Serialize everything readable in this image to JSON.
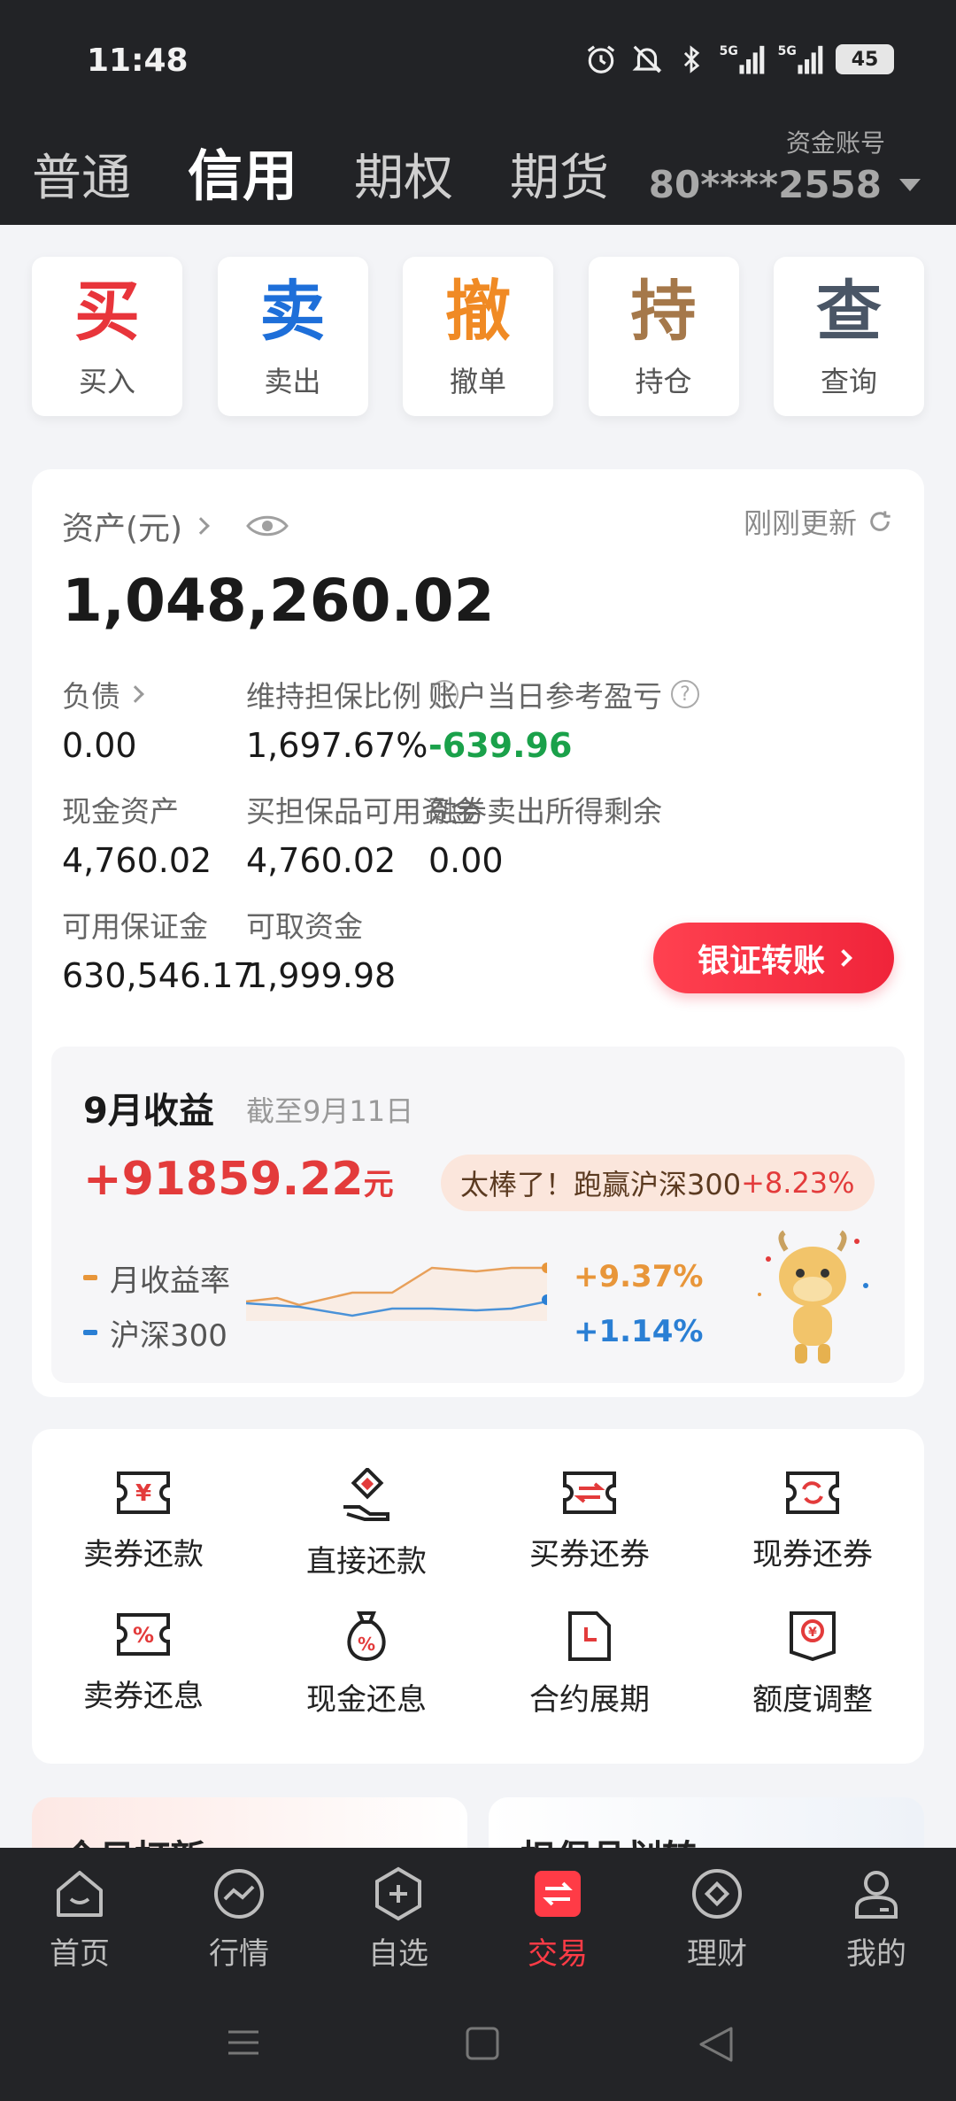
{
  "status": {
    "time": "11:48",
    "battery": "45",
    "network": "5G"
  },
  "tabs": [
    {
      "label": "普通"
    },
    {
      "label": "信用"
    },
    {
      "label": "期权"
    },
    {
      "label": "期货"
    }
  ],
  "account": {
    "label": "资金账号",
    "number": "80****2558"
  },
  "quick_actions": [
    {
      "char": "买",
      "label": "买入",
      "color": "#e8353b"
    },
    {
      "char": "卖",
      "label": "卖出",
      "color": "#1e6fd9"
    },
    {
      "char": "撤",
      "label": "撤单",
      "color": "#f08a24"
    },
    {
      "char": "持",
      "label": "持仓",
      "color": "#a5784a"
    },
    {
      "char": "查",
      "label": "查询",
      "color": "#4a5666"
    }
  ],
  "assets": {
    "title": "资产(元)",
    "refresh": "刚刚更新",
    "value": "1,048,260.02",
    "items": [
      {
        "label": "负债",
        "value": "0.00"
      },
      {
        "label": "维持担保比例",
        "value": "1,697.67%"
      },
      {
        "label": "账户当日参考盈亏",
        "value": "-639.96"
      },
      {
        "label": "现金资产",
        "value": "4,760.02"
      },
      {
        "label": "买担保品可用资金",
        "value": "4,760.02"
      },
      {
        "label": "融券卖出所得剩余",
        "value": "0.00"
      },
      {
        "label": "可用保证金",
        "value": "630,546.17"
      },
      {
        "label": "可取资金",
        "value": "1,999.98"
      }
    ],
    "transfer_label": "银证转账"
  },
  "income": {
    "title": "9月收益",
    "date": "截至9月11日",
    "value": "+91859.22",
    "unit": "元",
    "badge_text": "太棒了！跑赢沪深300",
    "badge_pct": "+8.23%",
    "legend": [
      {
        "name": "月收益率",
        "value": "+9.37%",
        "color": "#e8963a"
      },
      {
        "name": "沪深300",
        "value": "+1.14%",
        "color": "#2a7fd4"
      }
    ]
  },
  "functions": [
    {
      "label": "卖券还款",
      "icon": "ticket-yuan-icon"
    },
    {
      "label": "直接还款",
      "icon": "hand-coin-icon"
    },
    {
      "label": "买券还券",
      "icon": "ticket-swap-icon"
    },
    {
      "label": "现券还券",
      "icon": "ticket-cycle-icon"
    },
    {
      "label": "卖券还息",
      "icon": "ticket-percent-icon"
    },
    {
      "label": "现金还息",
      "icon": "money-bag-icon"
    },
    {
      "label": "合约展期",
      "icon": "document-clock-icon"
    },
    {
      "label": "额度调整",
      "icon": "certificate-yuan-icon"
    }
  ],
  "promos": [
    {
      "title": "今日打新"
    },
    {
      "title": "担保品划转"
    }
  ],
  "bottom_nav": [
    {
      "label": "首页",
      "icon": "home-icon"
    },
    {
      "label": "行情",
      "icon": "market-icon"
    },
    {
      "label": "自选",
      "icon": "watchlist-icon"
    },
    {
      "label": "交易",
      "icon": "trade-icon"
    },
    {
      "label": "理财",
      "icon": "wealth-icon"
    },
    {
      "label": "我的",
      "icon": "profile-icon"
    }
  ],
  "colors": {
    "accent": "#ff3b46",
    "header_bg": "#222326",
    "gain": "#1aa14a"
  }
}
